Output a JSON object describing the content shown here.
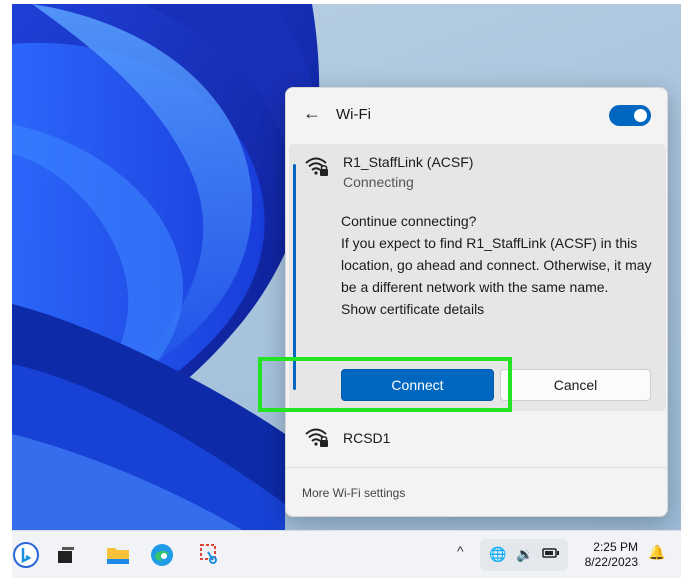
{
  "wifi_panel": {
    "title": "Wi-Fi",
    "toggle_on": true,
    "selected_network": {
      "name": "R1_StaffLink (ACSF)",
      "status": "Connecting",
      "prompt_heading": "Continue connecting?",
      "prompt_body": "If you expect to find R1_StaffLink (ACSF) in this location, go ahead and connect. Otherwise, it may be a different network with the same name.",
      "certificate_link": "Show certificate details",
      "connect_label": "Connect",
      "cancel_label": "Cancel"
    },
    "other_networks": [
      {
        "name": "RCSD1"
      }
    ],
    "more_settings_label": "More Wi-Fi settings"
  },
  "taskbar": {
    "pinned_icons": [
      "bing-icon",
      "task-view-icon",
      "file-explorer-icon",
      "edge-icon",
      "snipping-tool-icon"
    ],
    "tray_caret": "^",
    "time": "2:25 PM",
    "date": "8/22/2023"
  },
  "colors": {
    "accent": "#0067c0",
    "highlight_box": "#23e323",
    "panel_bg": "#f3f3f3"
  }
}
